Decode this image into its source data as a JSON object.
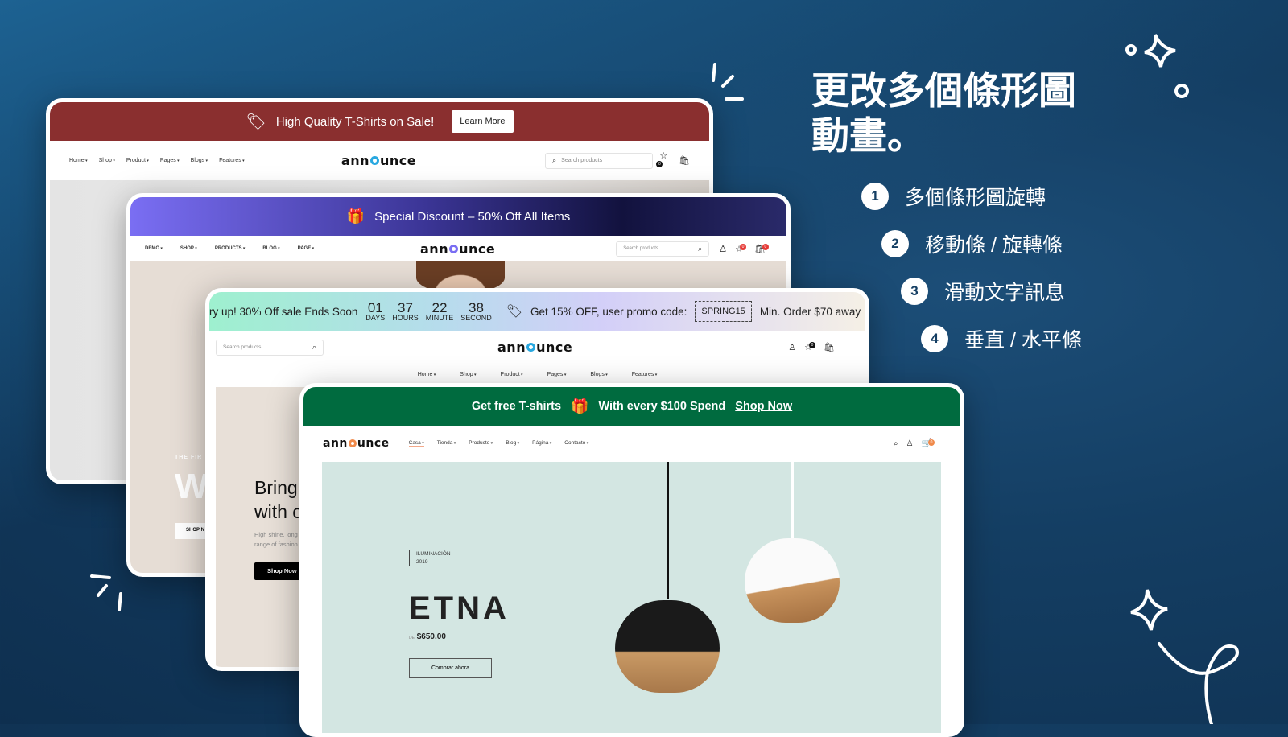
{
  "headline": {
    "line1": "更改多個條形圖",
    "line2": "動畫。"
  },
  "features": [
    {
      "n": "1",
      "label": "多個條形圖旋轉"
    },
    {
      "n": "2",
      "label": "移動條 / 旋轉條"
    },
    {
      "n": "3",
      "label": "滑動文字訊息"
    },
    {
      "n": "4",
      "label": "垂直 / 水平條"
    }
  ],
  "logo": {
    "a": "ann",
    "b": "unce",
    "full": "announce"
  },
  "card1": {
    "banner_text": "High Quality T-Shirts on Sale!",
    "banner_button": "Learn More",
    "menu": [
      "Home",
      "Shop",
      "Product",
      "Pages",
      "Blogs",
      "Features"
    ],
    "search_placeholder": "Search products",
    "wishlist_count": "0",
    "color": "#8a2f2f"
  },
  "card2": {
    "banner_text": "Special Discount – 50% Off All Items",
    "menu": [
      "DEMO",
      "SHOP",
      "PRODUCTS",
      "BLOG",
      "PAGE"
    ],
    "search_placeholder": "Search products",
    "wishlist_count": "0",
    "cart_count": "0",
    "hero": {
      "eyebrow": "THE FIR",
      "title": "W",
      "button": "SHOP N"
    }
  },
  "card3": {
    "banner_text": "ry up! 30% Off sale Ends Soon",
    "countdown": [
      {
        "v": "01",
        "u": "DAYS"
      },
      {
        "v": "37",
        "u": "HOURS"
      },
      {
        "v": "22",
        "u": "MINUTE"
      },
      {
        "v": "38",
        "u": "SECOND"
      }
    ],
    "promo_text": "Get 15% OFF, user promo code:",
    "promo_code": "SPRING15",
    "min_order": "Min. Order $70 away",
    "search_placeholder": "Search products",
    "wishlist_count": "0",
    "menu": [
      "Home",
      "Shop",
      "Product",
      "Pages",
      "Blogs",
      "Features"
    ],
    "hero": {
      "title1": "Bring",
      "title2": "with c",
      "desc1": "High shine, long",
      "desc2": "range of fashion",
      "button": "Shop Now"
    }
  },
  "card4": {
    "banner_text": "Get free T-shirts",
    "banner_text2": "With every $100 Spend",
    "banner_link": "Shop Now",
    "menu": [
      "Casa",
      "Tienda",
      "Producto",
      "Blog",
      "Página",
      "Contacto"
    ],
    "cart_count": "0",
    "hero": {
      "category": "ILUMINACIÓN",
      "year": "2019",
      "title": "ETNA",
      "price_prefix": "DE",
      "price": "$650.00",
      "button": "Comprar ahora"
    },
    "color": "#006b3f"
  }
}
